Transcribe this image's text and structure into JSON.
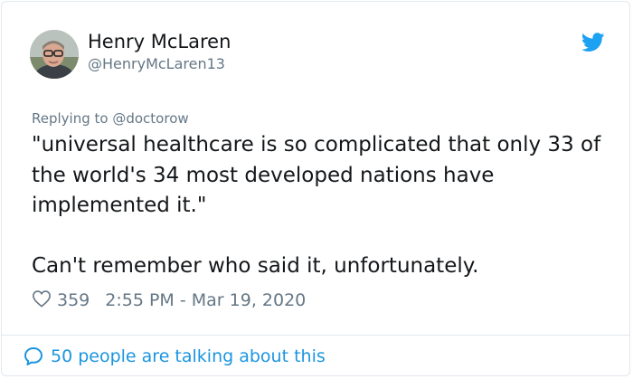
{
  "theme": {
    "accent": "#1b95e0",
    "text_primary": "#14171a",
    "text_secondary": "#657786",
    "border": "#e1e8ed"
  },
  "author": {
    "display_name": "Henry McLaren",
    "handle": "@HenryMcLaren13",
    "avatar_icon": "user-avatar-photo"
  },
  "platform_icon": "twitter-bird-icon",
  "reply": {
    "prefix": "Replying to",
    "to_user": "@doctorow"
  },
  "tweet": {
    "text": "\"universal healthcare is so complicated that only 33 of the world's 34 most developed nations have implemented it.\"\n\nCan't remember who said it, unfortunately."
  },
  "meta": {
    "like_icon": "heart-icon",
    "likes": "359",
    "timestamp": "2:55 PM - Mar 19, 2020"
  },
  "footer": {
    "icon": "speech-bubble-icon",
    "talking_label": "50 people are talking about this"
  }
}
